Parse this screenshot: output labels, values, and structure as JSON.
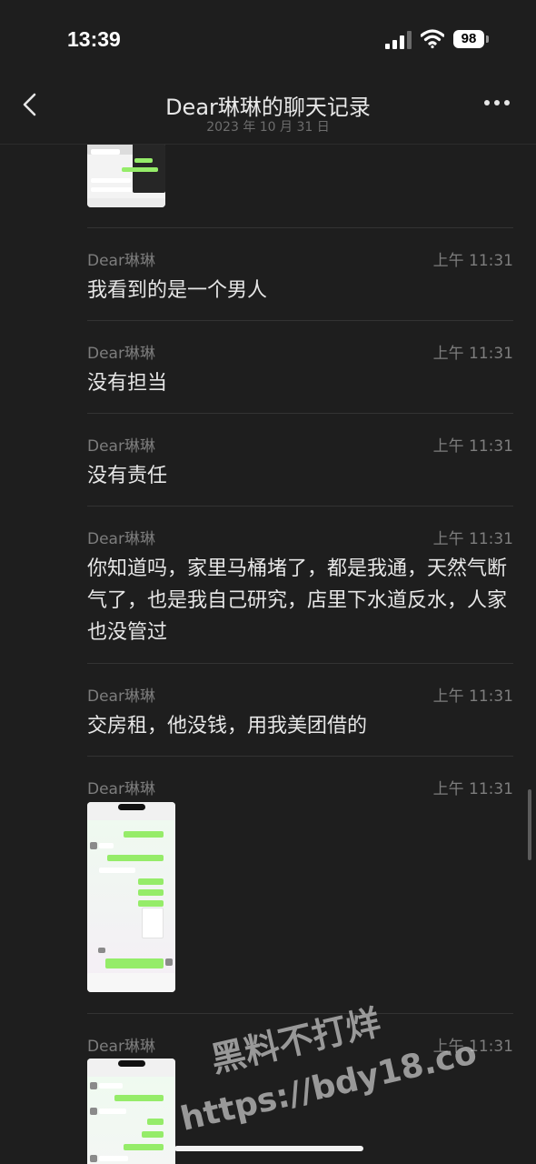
{
  "status": {
    "time": "13:39",
    "battery": "98"
  },
  "nav": {
    "title": "Dear琳琳的聊天记录",
    "date": "2023 年 10 月 31 日"
  },
  "messages": [
    {
      "sender": "Dear琳琳",
      "time": "上午 11:31",
      "text": "我看到的是一个男人"
    },
    {
      "sender": "Dear琳琳",
      "time": "上午 11:31",
      "text": "没有担当"
    },
    {
      "sender": "Dear琳琳",
      "time": "上午 11:31",
      "text": "没有责任"
    },
    {
      "sender": "Dear琳琳",
      "time": "上午 11:31",
      "text": "你知道吗，家里马桶堵了，都是我通，天然气断气了，也是我自己研究，店里下水道反水，人家也没管过"
    },
    {
      "sender": "Dear琳琳",
      "time": "上午 11:31",
      "text": "交房租，他没钱，用我美团借的"
    },
    {
      "sender": "Dear琳琳",
      "time": "上午 11:31",
      "text": ""
    },
    {
      "sender": "Dear琳琳",
      "time": "上午 11:31",
      "text": ""
    }
  ],
  "watermark": {
    "line1": "黑料不打烊",
    "line2": "https://bdy18.co"
  },
  "icons": {
    "back": "chevron-left-icon",
    "more": "more-dots-icon",
    "signal": "signal-icon",
    "wifi": "wifi-icon",
    "battery": "battery-icon"
  }
}
